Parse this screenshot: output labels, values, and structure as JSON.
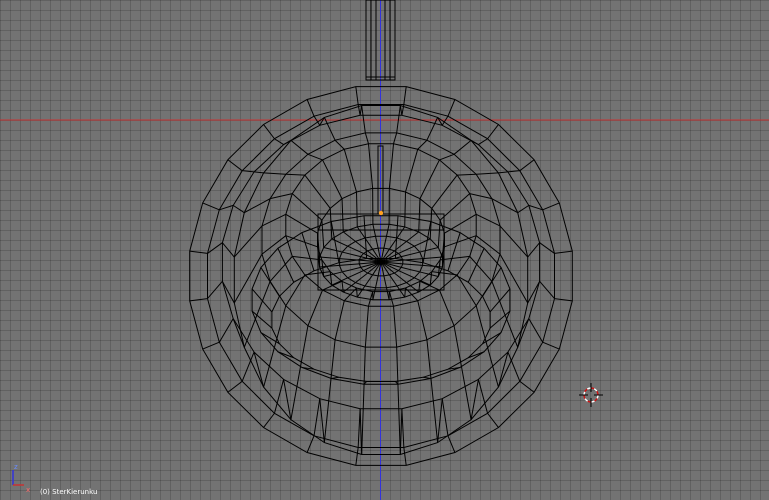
{
  "viewport": {
    "object_label": "(0) SterKierunku",
    "axis_z_label": "z",
    "axis_x_label": "x",
    "colors": {
      "background": "#737373",
      "grid": "#5e5e5e",
      "x_axis": "#c83232",
      "z_axis": "#3232dc",
      "wire": "#000000",
      "selected_vertex": "#ffa020",
      "cursor_red": "#d01010",
      "cursor_white": "#ffffff"
    },
    "icons": [
      "3d-cursor-icon",
      "axis-gizmo-icon",
      "object-origin-icon"
    ]
  }
}
